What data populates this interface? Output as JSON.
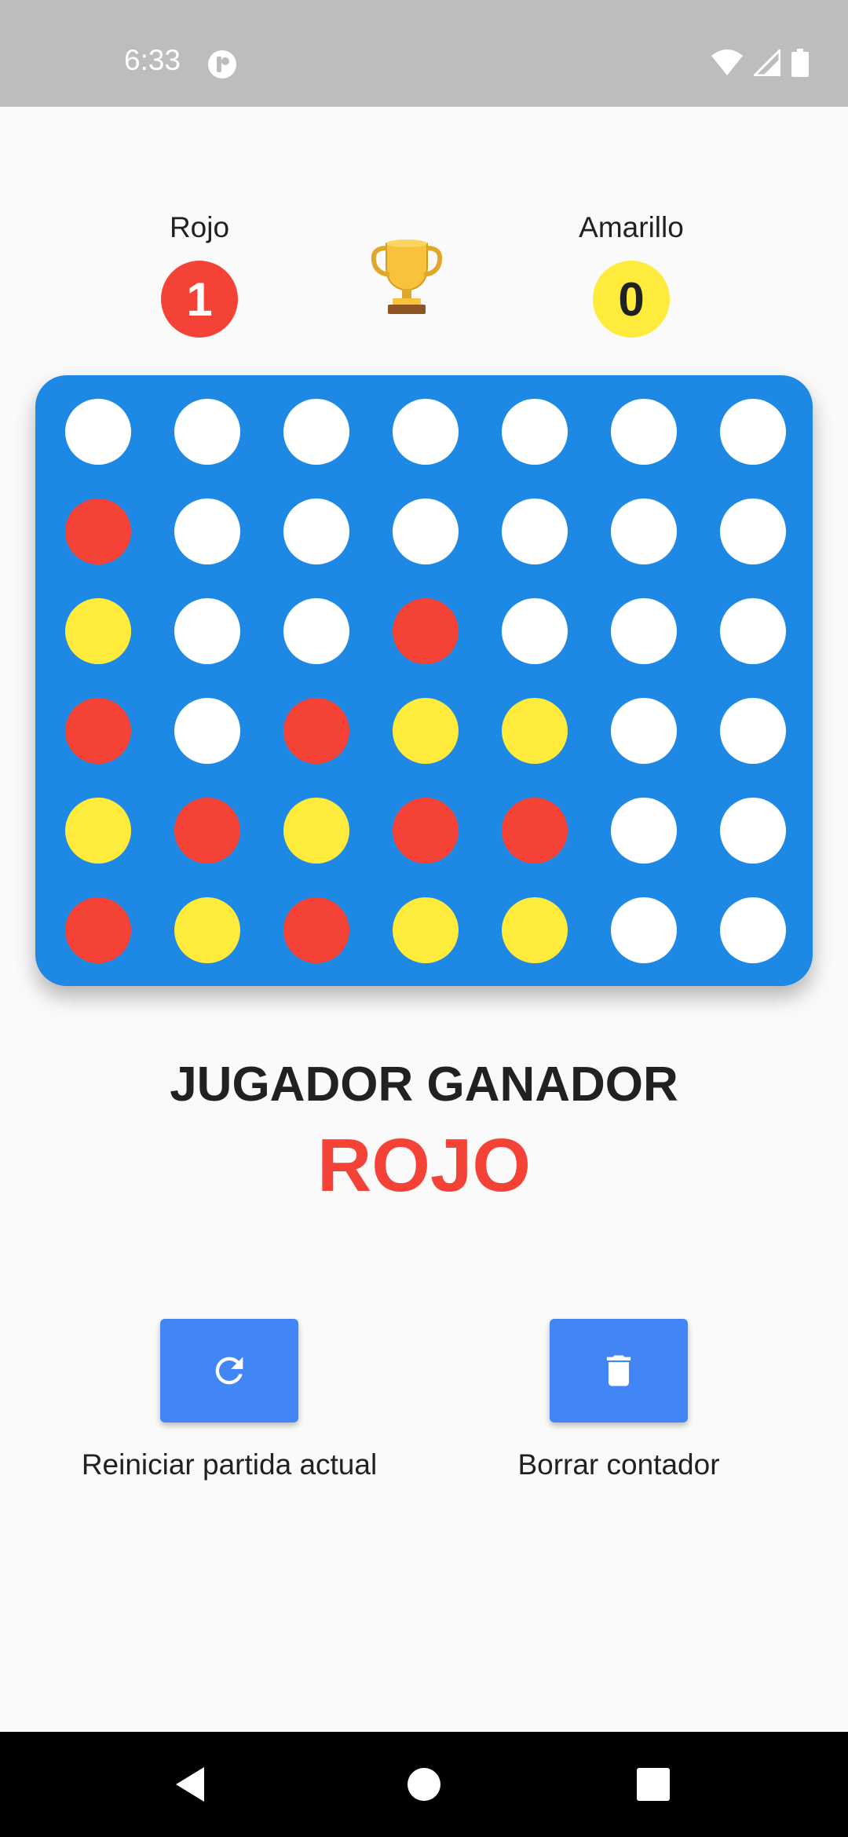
{
  "status_bar": {
    "time": "6:33",
    "icons": [
      "app-notification-icon",
      "wifi-icon",
      "signal-icon",
      "battery-icon"
    ]
  },
  "scoreboard": {
    "red": {
      "name": "Rojo",
      "score": "1",
      "color": "#f44336"
    },
    "yellow": {
      "name": "Amarillo",
      "score": "0",
      "color": "#ffeb3b"
    },
    "trophy_icon": "trophy-icon"
  },
  "board": {
    "color": "#1e88e5",
    "rows": [
      [
        "empty",
        "empty",
        "empty",
        "empty",
        "empty",
        "empty",
        "empty"
      ],
      [
        "red",
        "empty",
        "empty",
        "empty",
        "empty",
        "empty",
        "empty"
      ],
      [
        "yellow",
        "empty",
        "empty",
        "red",
        "empty",
        "empty",
        "empty"
      ],
      [
        "red",
        "empty",
        "red",
        "yellow",
        "yellow",
        "empty",
        "empty"
      ],
      [
        "yellow",
        "red",
        "yellow",
        "red",
        "red",
        "empty",
        "empty"
      ],
      [
        "red",
        "yellow",
        "red",
        "yellow",
        "yellow",
        "empty",
        "empty"
      ]
    ]
  },
  "result": {
    "title": "JUGADOR GANADOR",
    "winner": "ROJO"
  },
  "actions": {
    "restart": {
      "label": "Reiniciar partida actual",
      "icon": "refresh-icon"
    },
    "clear": {
      "label": "Borrar contador",
      "icon": "trash-icon"
    }
  },
  "nav": {
    "buttons": [
      "back-icon",
      "home-icon",
      "recents-icon"
    ]
  }
}
